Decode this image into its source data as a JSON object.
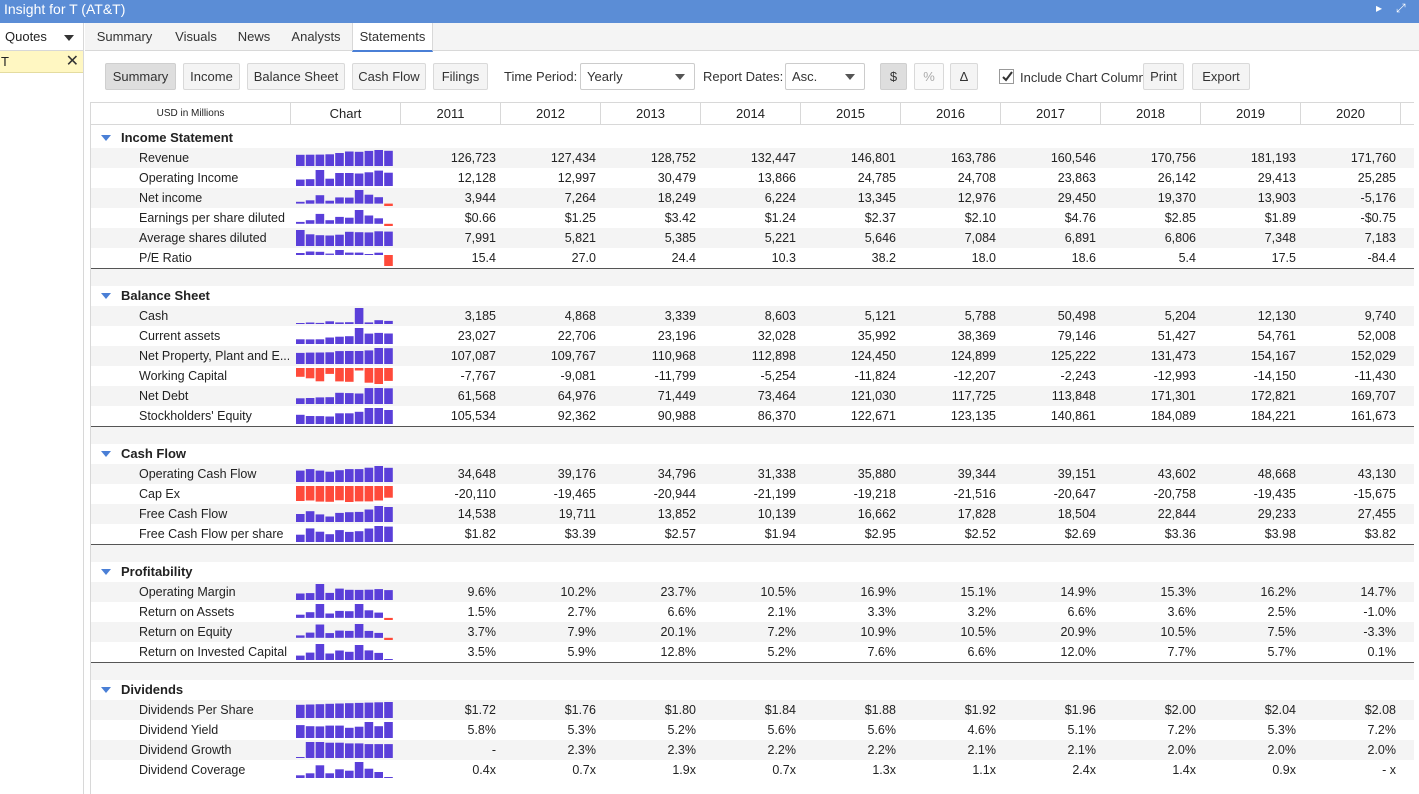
{
  "window": {
    "title": "Insight for T (AT&T)"
  },
  "sidebar": {
    "header": "Quotes",
    "symbol": "T"
  },
  "tabs": [
    "Summary",
    "Visuals",
    "News",
    "Analysts",
    "Statements"
  ],
  "active_tab": "Statements",
  "toolbar": {
    "buttons": [
      "Summary",
      "Income",
      "Balance Sheet",
      "Cash Flow",
      "Filings"
    ],
    "selected_button": "Summary",
    "time_period_label": "Time Period:",
    "time_period_value": "Yearly",
    "report_dates_label": "Report Dates:",
    "report_dates_value": "Asc.",
    "dollar_label": "$",
    "percent_label": "%",
    "delta_label": "Δ",
    "include_chart_label": "Include Chart Column",
    "include_chart_checked": true,
    "print_label": "Print",
    "export_label": "Export"
  },
  "table": {
    "units_label": "USD in Millions",
    "chart_header": "Chart",
    "years": [
      "2011",
      "2012",
      "2013",
      "2014",
      "2015",
      "2016",
      "2017",
      "2018",
      "2019",
      "2020"
    ],
    "sections": [
      {
        "title": "Income Statement",
        "rows": [
          {
            "label": "Revenue",
            "values": [
              "126,723",
              "127,434",
              "128,752",
              "132,447",
              "146,801",
              "163,786",
              "160,546",
              "170,756",
              "181,193",
              "171,760"
            ]
          },
          {
            "label": "Operating Income",
            "values": [
              "12,128",
              "12,997",
              "30,479",
              "13,866",
              "24,785",
              "24,708",
              "23,863",
              "26,142",
              "29,413",
              "25,285"
            ]
          },
          {
            "label": "Net income",
            "values": [
              "3,944",
              "7,264",
              "18,249",
              "6,224",
              "13,345",
              "12,976",
              "29,450",
              "19,370",
              "13,903",
              "-5,176"
            ]
          },
          {
            "label": "Earnings per share diluted",
            "values": [
              "$0.66",
              "$1.25",
              "$3.42",
              "$1.24",
              "$2.37",
              "$2.10",
              "$4.76",
              "$2.85",
              "$1.89",
              "-$0.75"
            ]
          },
          {
            "label": "Average shares diluted",
            "values": [
              "7,991",
              "5,821",
              "5,385",
              "5,221",
              "5,646",
              "7,084",
              "6,891",
              "6,806",
              "7,348",
              "7,183"
            ]
          },
          {
            "label": "P/E Ratio",
            "values": [
              "15.4",
              "27.0",
              "24.4",
              "10.3",
              "38.2",
              "18.0",
              "18.6",
              "5.4",
              "17.5",
              "-84.4"
            ]
          }
        ]
      },
      {
        "title": "Balance Sheet",
        "rows": [
          {
            "label": "Cash",
            "values": [
              "3,185",
              "4,868",
              "3,339",
              "8,603",
              "5,121",
              "5,788",
              "50,498",
              "5,204",
              "12,130",
              "9,740"
            ]
          },
          {
            "label": "Current assets",
            "values": [
              "23,027",
              "22,706",
              "23,196",
              "32,028",
              "35,992",
              "38,369",
              "79,146",
              "51,427",
              "54,761",
              "52,008"
            ]
          },
          {
            "label": "Net Property, Plant and E...",
            "values": [
              "107,087",
              "109,767",
              "110,968",
              "112,898",
              "124,450",
              "124,899",
              "125,222",
              "131,473",
              "154,167",
              "152,029"
            ]
          },
          {
            "label": "Working Capital",
            "values": [
              "-7,767",
              "-9,081",
              "-11,799",
              "-5,254",
              "-11,824",
              "-12,207",
              "-2,243",
              "-12,993",
              "-14,150",
              "-11,430"
            ]
          },
          {
            "label": "Net Debt",
            "values": [
              "61,568",
              "64,976",
              "71,449",
              "73,464",
              "121,030",
              "117,725",
              "113,848",
              "171,301",
              "172,821",
              "169,707"
            ]
          },
          {
            "label": "Stockholders' Equity",
            "values": [
              "105,534",
              "92,362",
              "90,988",
              "86,370",
              "122,671",
              "123,135",
              "140,861",
              "184,089",
              "184,221",
              "161,673"
            ]
          }
        ]
      },
      {
        "title": "Cash Flow",
        "rows": [
          {
            "label": "Operating Cash Flow",
            "values": [
              "34,648",
              "39,176",
              "34,796",
              "31,338",
              "35,880",
              "39,344",
              "39,151",
              "43,602",
              "48,668",
              "43,130"
            ]
          },
          {
            "label": "Cap Ex",
            "values": [
              "-20,110",
              "-19,465",
              "-20,944",
              "-21,199",
              "-19,218",
              "-21,516",
              "-20,647",
              "-20,758",
              "-19,435",
              "-15,675"
            ]
          },
          {
            "label": "Free Cash Flow",
            "values": [
              "14,538",
              "19,711",
              "13,852",
              "10,139",
              "16,662",
              "17,828",
              "18,504",
              "22,844",
              "29,233",
              "27,455"
            ]
          },
          {
            "label": "Free Cash Flow per share",
            "values": [
              "$1.82",
              "$3.39",
              "$2.57",
              "$1.94",
              "$2.95",
              "$2.52",
              "$2.69",
              "$3.36",
              "$3.98",
              "$3.82"
            ]
          }
        ]
      },
      {
        "title": "Profitability",
        "rows": [
          {
            "label": "Operating Margin",
            "values": [
              "9.6%",
              "10.2%",
              "23.7%",
              "10.5%",
              "16.9%",
              "15.1%",
              "14.9%",
              "15.3%",
              "16.2%",
              "14.7%"
            ]
          },
          {
            "label": "Return on Assets",
            "values": [
              "1.5%",
              "2.7%",
              "6.6%",
              "2.1%",
              "3.3%",
              "3.2%",
              "6.6%",
              "3.6%",
              "2.5%",
              "-1.0%"
            ]
          },
          {
            "label": "Return on Equity",
            "values": [
              "3.7%",
              "7.9%",
              "20.1%",
              "7.2%",
              "10.9%",
              "10.5%",
              "20.9%",
              "10.5%",
              "7.5%",
              "-3.3%"
            ]
          },
          {
            "label": "Return on Invested Capital",
            "values": [
              "3.5%",
              "5.9%",
              "12.8%",
              "5.2%",
              "7.6%",
              "6.6%",
              "12.0%",
              "7.7%",
              "5.7%",
              "0.1%"
            ]
          }
        ]
      },
      {
        "title": "Dividends",
        "rows": [
          {
            "label": "Dividends Per Share",
            "values": [
              "$1.72",
              "$1.76",
              "$1.80",
              "$1.84",
              "$1.88",
              "$1.92",
              "$1.96",
              "$2.00",
              "$2.04",
              "$2.08"
            ]
          },
          {
            "label": "Dividend Yield",
            "values": [
              "5.8%",
              "5.3%",
              "5.2%",
              "5.6%",
              "5.6%",
              "4.6%",
              "5.1%",
              "7.2%",
              "5.3%",
              "7.2%"
            ]
          },
          {
            "label": "Dividend Growth",
            "values": [
              "-",
              "2.3%",
              "2.3%",
              "2.2%",
              "2.2%",
              "2.1%",
              "2.1%",
              "2.0%",
              "2.0%",
              "2.0%"
            ]
          },
          {
            "label": "Dividend Coverage",
            "values": [
              "0.4x",
              "0.7x",
              "1.9x",
              "0.7x",
              "1.3x",
              "1.1x",
              "2.4x",
              "1.4x",
              "0.9x",
              "- x"
            ]
          }
        ]
      }
    ]
  },
  "colors": {
    "title_bar": "#5b8dd6",
    "positive_bar": "#5a3fd9",
    "negative_bar": "#ff4a3a",
    "symbol_highlight": "#fff7c2",
    "accent": "#4a7fd6"
  },
  "icons": [
    "close-icon",
    "dropdown-arrow-icon",
    "checkbox-check-icon",
    "collapse-triangle-icon",
    "window-expand-icon",
    "window-menu-icon"
  ]
}
